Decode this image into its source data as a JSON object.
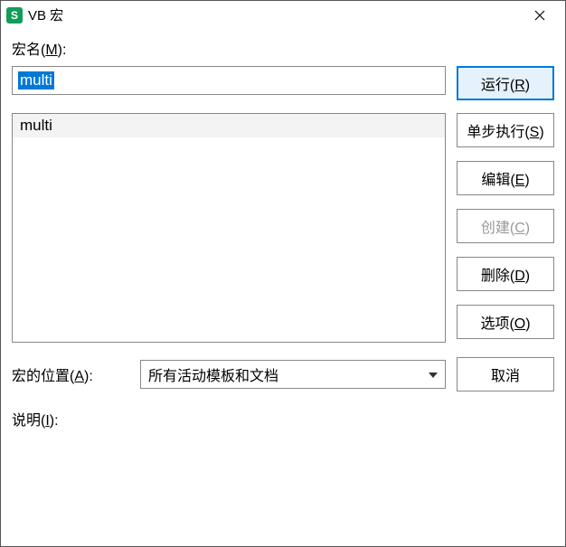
{
  "titlebar": {
    "icon_letter": "S",
    "title": "VB 宏"
  },
  "labels": {
    "macro_name": "宏名(",
    "macro_name_key": "M",
    "macro_name_after": "):",
    "location": "宏的位置(",
    "location_key": "A",
    "location_after": "):",
    "description": "说明(",
    "description_key": "I",
    "description_after": "):"
  },
  "input": {
    "value": "multi"
  },
  "list": {
    "items": [
      "multi"
    ]
  },
  "buttons": {
    "run": "运行(",
    "run_key": "R",
    "run_after": ")",
    "step": "单步执行(",
    "step_key": "S",
    "step_after": ")",
    "edit": "编辑(",
    "edit_key": "E",
    "edit_after": ")",
    "create": "创建(",
    "create_key": "C",
    "create_after": ")",
    "delete": "删除(",
    "delete_key": "D",
    "delete_after": ")",
    "options": "选项(",
    "options_key": "O",
    "options_after": ")",
    "cancel": "取消"
  },
  "location_select": {
    "selected": "所有活动模板和文档"
  }
}
